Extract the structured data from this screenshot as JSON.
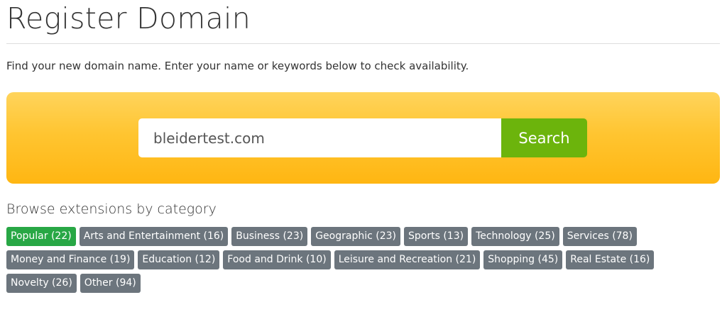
{
  "page": {
    "title": "Register Domain",
    "intro": "Find your new domain name. Enter your name or keywords below to check availability."
  },
  "search": {
    "value": "bleidertest.com",
    "button_label": "Search",
    "panel_color": "#ffc531",
    "button_color": "#6cb40c"
  },
  "browse": {
    "heading": "Browse extensions by category",
    "active_color": "#28a745",
    "inactive_color": "#6c757d",
    "rows": [
      [
        {
          "label": "Popular (22)",
          "active": true
        },
        {
          "label": "Arts and Entertainment (16)"
        },
        {
          "label": "Business (23)"
        },
        {
          "label": "Geographic (23)"
        },
        {
          "label": "Sports (13)"
        },
        {
          "label": "Technology (25)"
        },
        {
          "label": "Services (78)"
        }
      ],
      [
        {
          "label": "Money and Finance (19)"
        },
        {
          "label": "Education (12)"
        },
        {
          "label": "Food and Drink (10)"
        },
        {
          "label": "Leisure and Recreation (21)"
        },
        {
          "label": "Shopping (45)"
        },
        {
          "label": "Real Estate (16)"
        }
      ],
      [
        {
          "label": "Novelty (26)"
        },
        {
          "label": "Other (94)"
        }
      ]
    ]
  }
}
